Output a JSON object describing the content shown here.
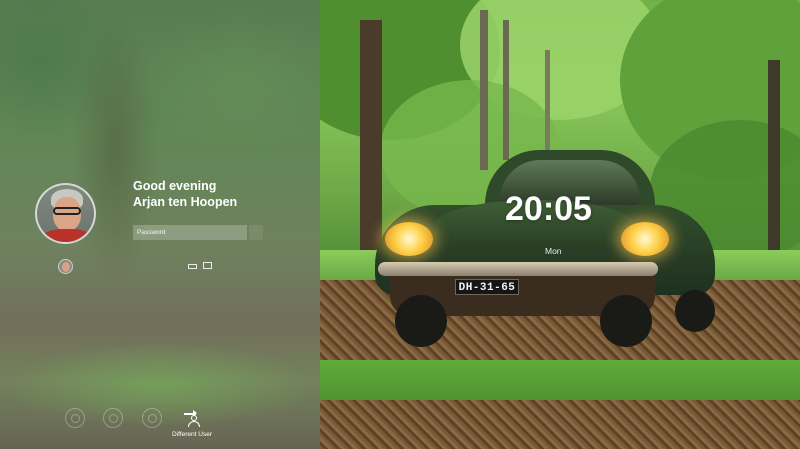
{
  "login": {
    "greeting": "Good evening",
    "user_name": "Arjan ten Hoopen",
    "password_placeholder": "Password",
    "different_user_label": "Different User",
    "icons": {
      "keyboard": "keyboard-icon",
      "monitor": "monitor-icon",
      "accessibility_1": "accessibility-icon",
      "accessibility_2": "settings-icon",
      "power": "power-icon",
      "different_user": "switch-user-icon"
    }
  },
  "lock_screen": {
    "time": "20:05",
    "date": "Mon",
    "license_plate": "DH-31-65"
  },
  "colors": {
    "text": "#ffffff",
    "input_bg": "rgba(255,255,255,0.22)"
  }
}
